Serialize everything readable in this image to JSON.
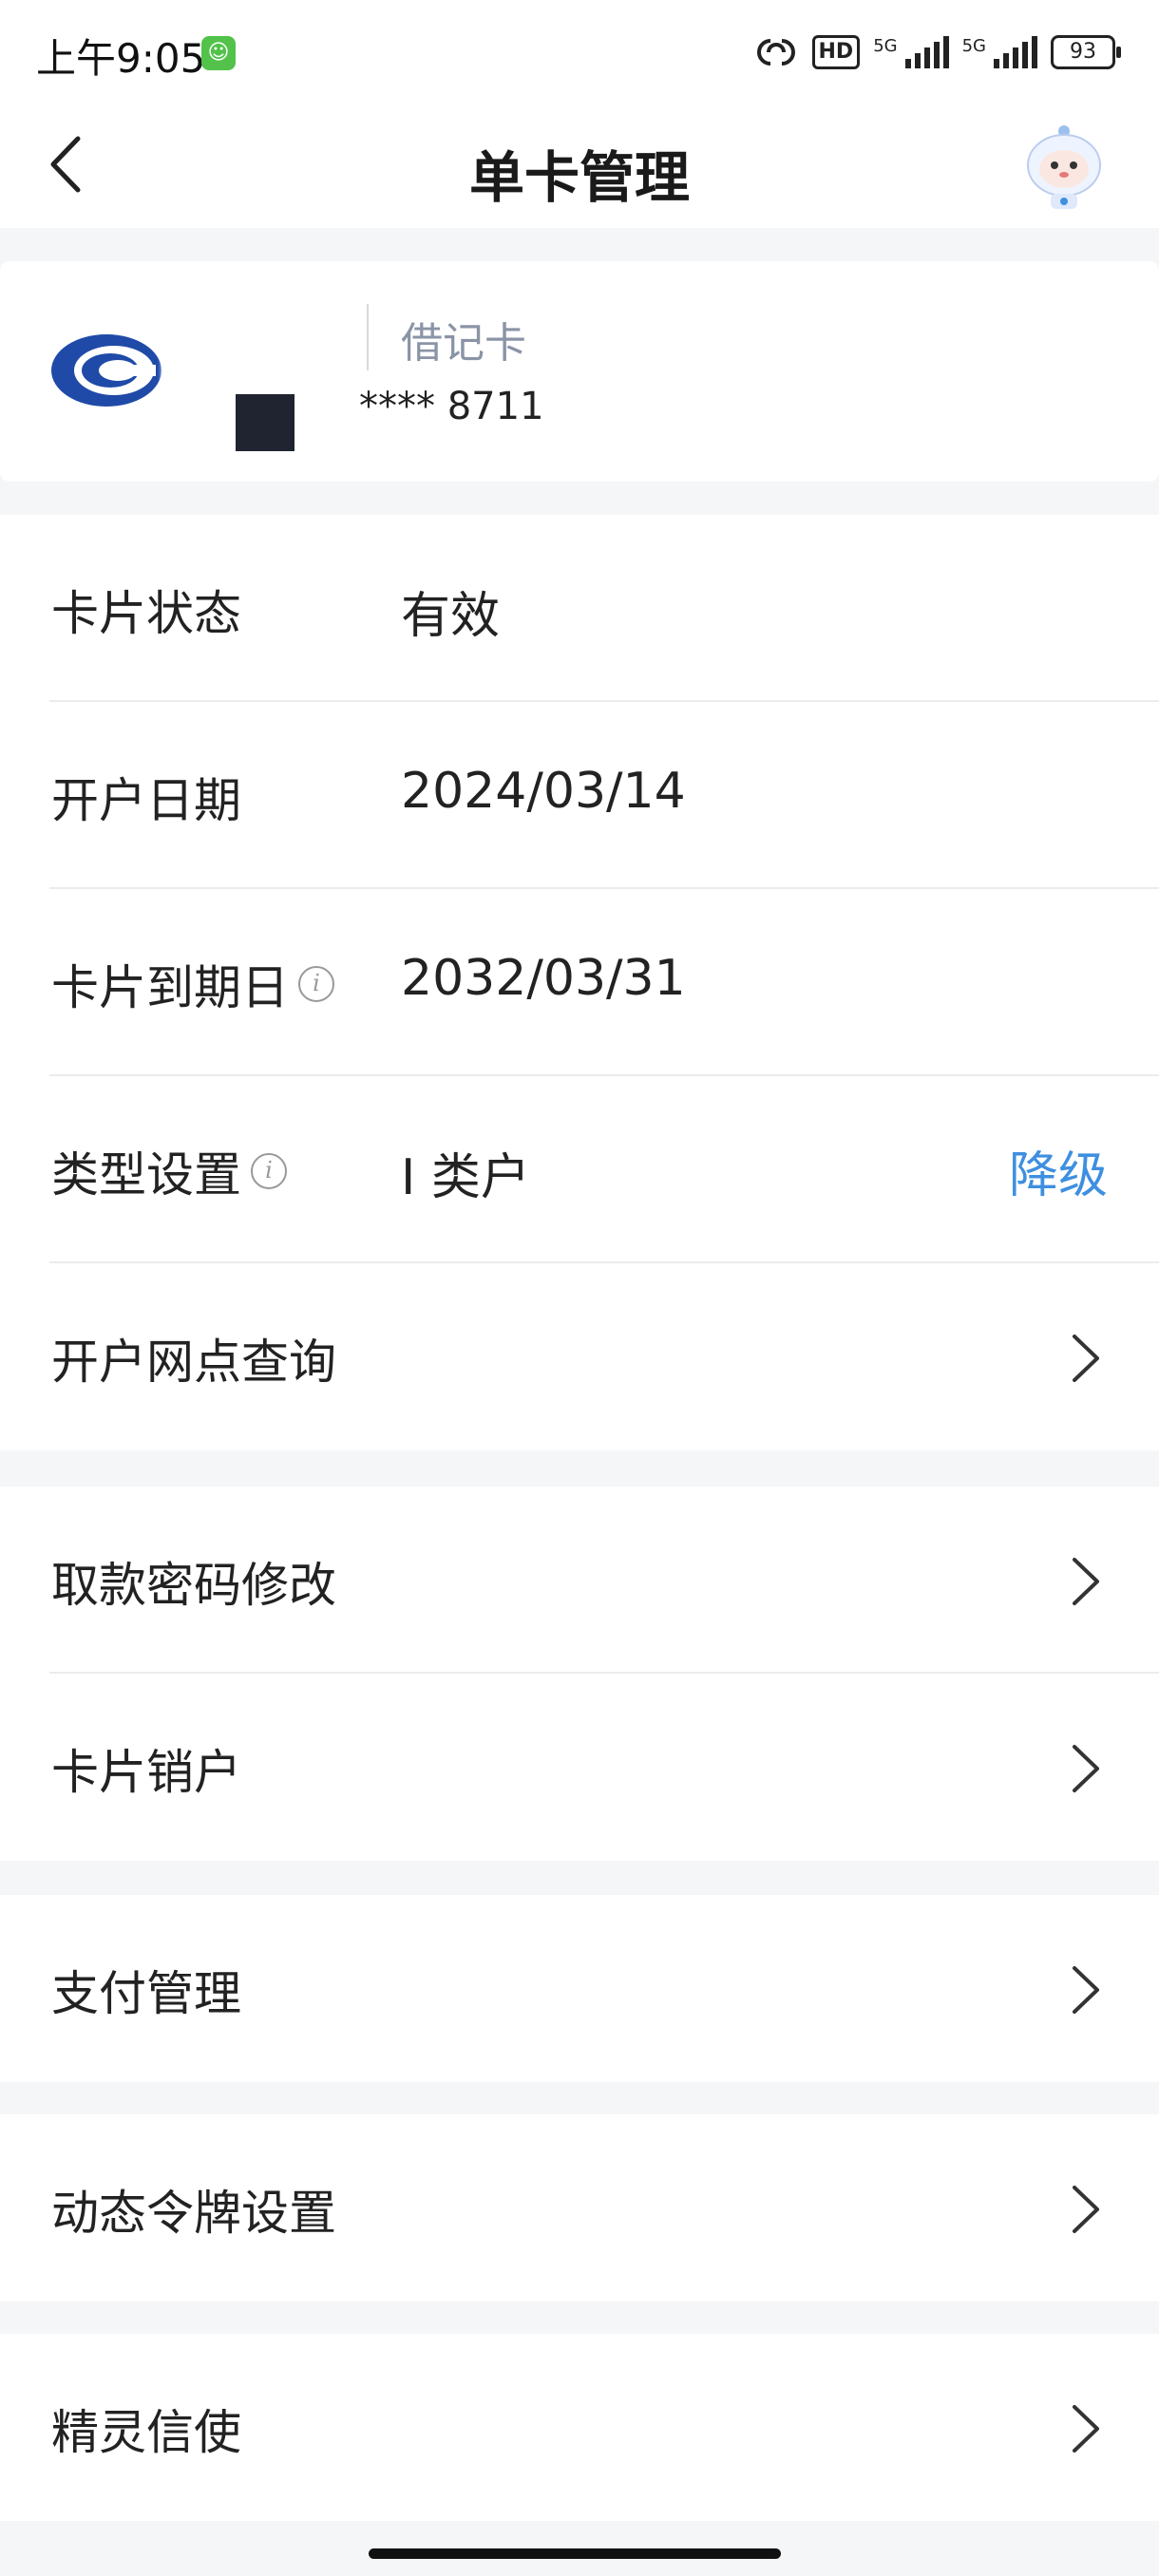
{
  "status_bar": {
    "time": "上午9:05",
    "hd_label": "HD",
    "signal1_label": "5G",
    "signal2_label": "5G",
    "battery": "93"
  },
  "nav": {
    "title": "单卡管理"
  },
  "card": {
    "type": "借记卡",
    "number": "**** 8711"
  },
  "details": [
    {
      "label": "卡片状态",
      "value": "有效"
    },
    {
      "label": "开户日期",
      "value": "2024/03/14"
    },
    {
      "label": "卡片到期日",
      "value": "2032/03/31",
      "info_icon": "i"
    },
    {
      "label": "类型设置",
      "value": "I 类户",
      "info_icon": "i",
      "action": "降级"
    },
    {
      "label": "开户网点查询"
    }
  ],
  "security": [
    {
      "label": "取款密码修改"
    },
    {
      "label": "卡片销户"
    }
  ],
  "menu": {
    "payment": "支付管理",
    "token": "动态令牌设置",
    "messenger": "精灵信使"
  },
  "colors": {
    "accent": "#3e8fe0",
    "bank_logo": "#1f4aa8",
    "background": "#f5f6f8"
  }
}
